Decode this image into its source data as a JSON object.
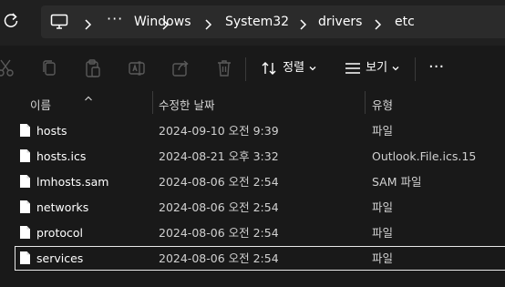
{
  "breadcrumb": {
    "overflow": "···",
    "items": [
      {
        "label": "Windows"
      },
      {
        "label": "System32"
      },
      {
        "label": "drivers"
      },
      {
        "label": "etc"
      }
    ]
  },
  "toolbar": {
    "sort_label": "정렬",
    "view_label": "보기",
    "more_label": "···",
    "icons": [
      "cut-icon",
      "copy-icon",
      "paste-icon",
      "rename-icon",
      "share-icon",
      "delete-icon"
    ]
  },
  "columns": {
    "name": "이름",
    "date": "수정한 날짜",
    "type": "유형"
  },
  "files": [
    {
      "name": "hosts",
      "date": "2024-09-10 오전 9:39",
      "type": "파일"
    },
    {
      "name": "hosts.ics",
      "date": "2024-08-21 오후 3:32",
      "type": "Outlook.File.ics.15"
    },
    {
      "name": "lmhosts.sam",
      "date": "2024-08-06 오전 2:54",
      "type": "SAM 파일"
    },
    {
      "name": "networks",
      "date": "2024-08-06 오전 2:54",
      "type": "파일"
    },
    {
      "name": "protocol",
      "date": "2024-08-06 오전 2:54",
      "type": "파일"
    },
    {
      "name": "services",
      "date": "2024-08-06 오전 2:54",
      "type": "파일",
      "selected": true
    }
  ],
  "colors": {
    "background": "#191919",
    "address_bar": "#2b2b2b",
    "text": "#ffffff",
    "disabled_icon": "#5a5a5a"
  }
}
